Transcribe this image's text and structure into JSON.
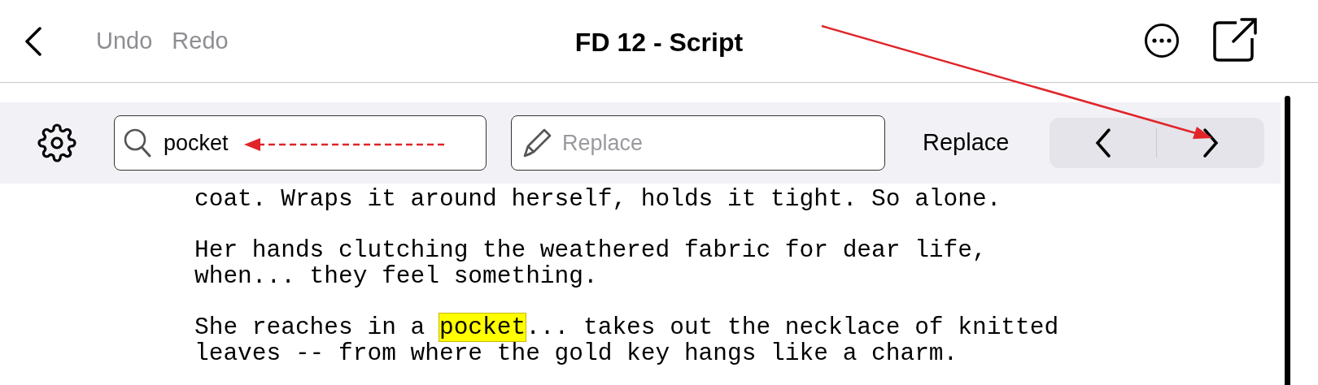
{
  "header": {
    "title": "FD 12 - Script",
    "undo": {
      "label": "Undo",
      "disabled": true
    },
    "redo": {
      "label": "Redo",
      "disabled": true
    }
  },
  "find_bar": {
    "search": {
      "value": "pocket"
    },
    "replace_field": {
      "placeholder": "Replace"
    },
    "replace_button": "Replace"
  },
  "script": [
    {
      "runs": [
        {
          "text": "coat. Wraps it around herself, holds it tight. So alone.",
          "highlighted": false
        }
      ]
    },
    {
      "runs": [
        {
          "text": "Her hands clutching the weathered fabric for dear life,\nwhen... they feel something.",
          "highlighted": false
        }
      ]
    },
    {
      "runs": [
        {
          "text": "She reaches in a ",
          "highlighted": false
        },
        {
          "text": "pocket",
          "highlighted": true
        },
        {
          "text": "... takes out the necklace of knitted\nleaves -- from where the gold key hangs like a charm.",
          "highlighted": false
        }
      ]
    }
  ]
}
